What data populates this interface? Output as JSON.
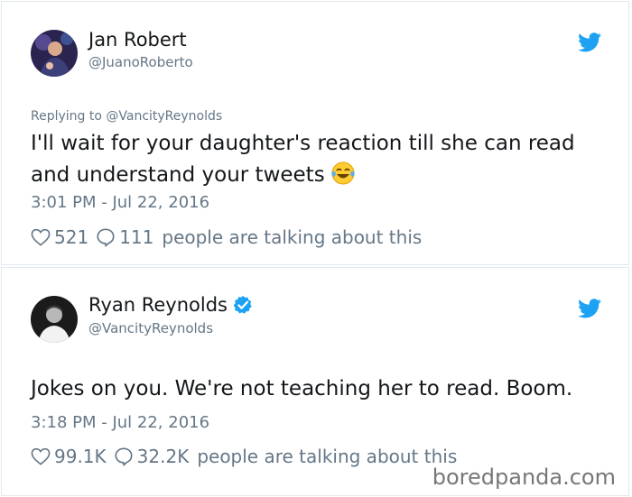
{
  "tweets": [
    {
      "name": "Jan Robert",
      "handle": "@JuanoRoberto",
      "verified": false,
      "replying_to": "Replying to @VancityReynolds",
      "text": "I'll wait for your daughter's reaction till she can read and understand your tweets",
      "emoji": "face-with-tears-of-joy",
      "time": "3:01 PM - Jul 22, 2016",
      "likes": "521",
      "replies": "111",
      "talking": "people are talking about this"
    },
    {
      "name": "Ryan Reynolds",
      "handle": "@VancityReynolds",
      "verified": true,
      "text": "Jokes on you. We're not teaching her to read. Boom.",
      "time": "3:18 PM - Jul 22, 2016",
      "likes": "99.1K",
      "replies": "32.2K",
      "talking": "people are talking about this"
    }
  ],
  "watermark": "boredpanda.com",
  "colors": {
    "twitter_blue": "#1da1f2",
    "secondary_text": "#657786",
    "border": "#e1e8ed"
  }
}
